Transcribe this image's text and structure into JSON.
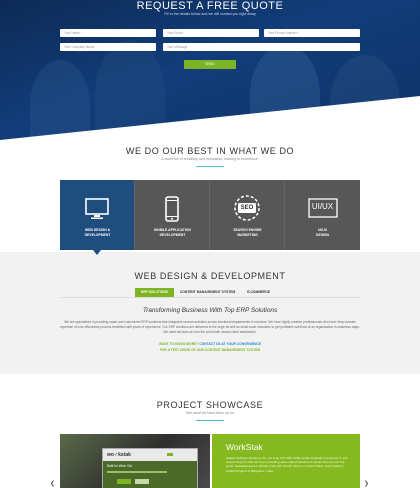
{
  "hero": {
    "title": "REQUEST A FREE QUOTE",
    "subtitle": "Fill in the details below and we will contact you right away",
    "fields": {
      "name_placeholder": "Your Name *",
      "email_placeholder": "Your Email *",
      "phone_placeholder": "Your Phone Number *",
      "company_placeholder": "Your Company Name",
      "message_placeholder": "Your Message"
    },
    "send_label": "SEND"
  },
  "best": {
    "title": "WE DO OUR BEST IN WHAT WE DO",
    "subtitle": "A world full of creativity and innovation, leading to excellence.",
    "services": [
      {
        "line1": "WEB DESIGN &",
        "line2": "DEVELOPMENT",
        "icon": "monitor-icon",
        "active": true
      },
      {
        "line1": "MOBILE APPLICATION",
        "line2": "DEVELOPMENT",
        "icon": "mobile-icon",
        "active": false
      },
      {
        "line1": "SEARCH ENGINE",
        "line2": "MARKETING",
        "icon": "seo-icon",
        "active": false
      },
      {
        "line1": "UI/UX",
        "line2": "DESIGN",
        "icon": "ui-ux-icon",
        "active": false
      }
    ],
    "seo_text": "SEO",
    "uiux_text": "UI/UX"
  },
  "webdev": {
    "title": "WEB DESIGN & DEVELOPMENT",
    "tabs": [
      "ERP SOLUTIONS",
      "CONTENT MANAGEMENT SYSTEM",
      "E-COMMERCE"
    ],
    "heading": "Transforming Business With Top ERP Solutions",
    "paragraph": "We are specialized in providing smart and customized ERP solutions that integrates several activities across functional departments in real-time. We have highly creative professionals who have deep domain expertise of core eBusiness process benefited with years of experience. Our ERP solutions are delivered to the large as well as small scale industries to get profitable workflow of an organization in seamless ways. We cater services all over the world with utmost client satisfaction.",
    "cta1": "WANT TO KNOW MORE?",
    "cta1_link": "CONTACT US AT YOUR CONVENIENCE",
    "cta2": "FOR A TEST DRIVE OF OUR CONTENT MANAGEMENT SYSTEM"
  },
  "showcase": {
    "title": "PROJECT SHOWCASE",
    "subtitle": "See what we have been up to!",
    "project_name": "WorkStak",
    "project_desc": "Hellcat Software Solutions Pvt. Ltd is an ISO 9001:2008 certified globally recognized IT and outsourcing firm that has been providing value added solutions to clients from all over the world. Headquartered in Mohali, India with branch offices in United States, New Zealand, United Kingdom & Bangalore, India.",
    "mock_logo": "wo✓kstak",
    "mock_tagline": "Built for Work Out"
  },
  "colors": {
    "navy": "#1e4d7e",
    "green": "#7db424",
    "dark_tile": "#575757",
    "accent_blue": "#58b8d8"
  }
}
